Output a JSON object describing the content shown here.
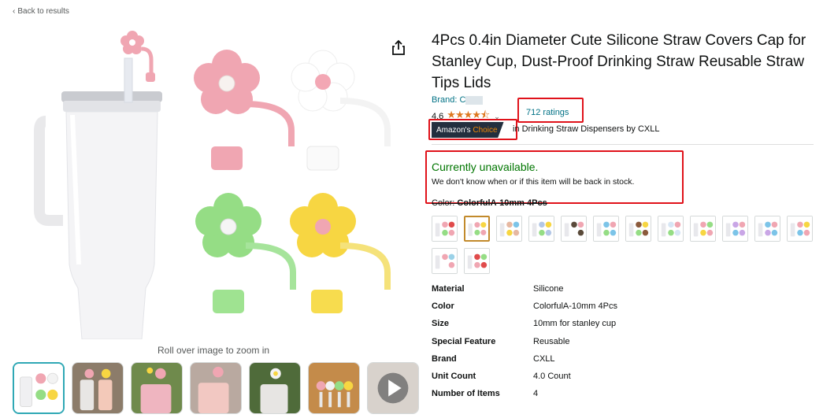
{
  "nav": {
    "back_label": "Back to results"
  },
  "product": {
    "title": "4Pcs 0.4in Diameter Cute Silicone Straw Covers Cap for Stanley Cup, Dust-Proof Drinking Straw Reusable Straw Tips Lids",
    "brand_label": "Brand: C",
    "rating_value": "4.6",
    "stars_display": "★★★★⯪",
    "ratings_count": "712 ratings",
    "badge_prefix": "Amazon's",
    "badge_suffix": "Choice",
    "badge_category": "in Drinking Straw Dispensers by CXLL",
    "availability": "Currently unavailable.",
    "availability_note": "We don't know when or if this item will be back in stock.",
    "color_label": "Color:",
    "color_value": "ColorfulA-10mm 4Pcs"
  },
  "gallery": {
    "zoom_hint": "Roll over image to zoom in",
    "thumb_count": 7,
    "selected_index": 0
  },
  "swatch_count": 14,
  "selected_swatch_index": 1,
  "specs": [
    {
      "key": "Material",
      "value": "Silicone"
    },
    {
      "key": "Color",
      "value": "ColorfulA-10mm 4Pcs"
    },
    {
      "key": "Size",
      "value": "10mm for stanley cup"
    },
    {
      "key": "Special Feature",
      "value": "Reusable"
    },
    {
      "key": "Brand",
      "value": "CXLL"
    },
    {
      "key": "Unit Count",
      "value": "4.0 Count"
    },
    {
      "key": "Number of Items",
      "value": "4"
    }
  ],
  "colors": {
    "link": "#007185",
    "available_green": "#007600",
    "star": "#de7921",
    "badge_bg": "#232f3e",
    "badge_accent": "#f08804",
    "highlight_red": "#e0121a",
    "flower_pink": "#f0a6b2",
    "flower_white": "#ffffff",
    "flower_green": "#95dd85",
    "flower_yellow": "#f7d642"
  },
  "icons": [
    "chevron-left-icon",
    "share-icon",
    "play-icon",
    "star-icon"
  ]
}
